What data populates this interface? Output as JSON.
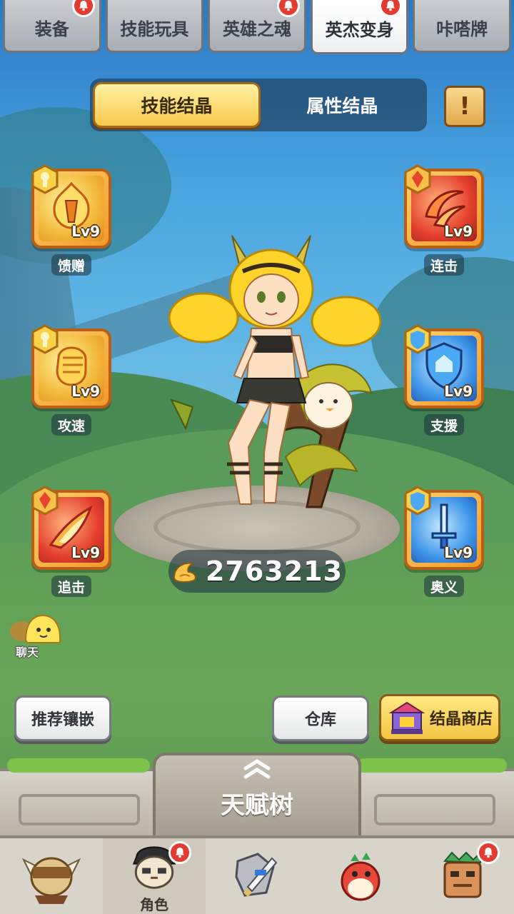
{
  "top_tabs": [
    {
      "label": "装备",
      "active": false,
      "notify": true
    },
    {
      "label": "技能玩具",
      "active": false,
      "notify": false
    },
    {
      "label": "英雄之魂",
      "active": false,
      "notify": true
    },
    {
      "label": "英杰变身",
      "active": true,
      "notify": true
    },
    {
      "label": "咔嗒牌",
      "active": false,
      "notify": false
    }
  ],
  "segment": {
    "tabs": [
      {
        "label": "技能结晶",
        "active": true
      },
      {
        "label": "属性结晶",
        "active": false
      }
    ],
    "info_icon": "scroll-exclamation-icon"
  },
  "slots_left": [
    {
      "name": "馈赠",
      "level": "Lv9",
      "color": "yellow"
    },
    {
      "name": "攻速",
      "level": "Lv9",
      "color": "yellow"
    },
    {
      "name": "追击",
      "level": "Lv9",
      "color": "red"
    }
  ],
  "slots_right": [
    {
      "name": "连击",
      "level": "Lv9",
      "color": "red"
    },
    {
      "name": "支援",
      "level": "Lv9",
      "color": "blue"
    },
    {
      "name": "奥义",
      "level": "Lv9",
      "color": "blue"
    }
  ],
  "currency": {
    "value": "2763213",
    "icon": "crystal-claw-icon"
  },
  "chat": {
    "label": "聊天"
  },
  "actions": {
    "recommend": "推荐镶嵌",
    "warehouse": "仓库",
    "shop": "结晶商店"
  },
  "talent": {
    "title": "天赋树"
  },
  "bottom_nav": [
    {
      "label": "",
      "icon": "tribe-hero-icon",
      "active": false,
      "notify": false
    },
    {
      "label": "角色",
      "icon": "character-icon",
      "active": true,
      "notify": true
    },
    {
      "label": "",
      "icon": "sword-shield-icon",
      "active": false,
      "notify": false
    },
    {
      "label": "",
      "icon": "pet-dragon-icon",
      "active": false,
      "notify": false
    },
    {
      "label": "",
      "icon": "totem-icon",
      "active": false,
      "notify": true
    }
  ],
  "colors": {
    "accent_gold": "#f7c84b",
    "notify_red": "#e53a2f",
    "slot_frame": "#f29a2c"
  }
}
